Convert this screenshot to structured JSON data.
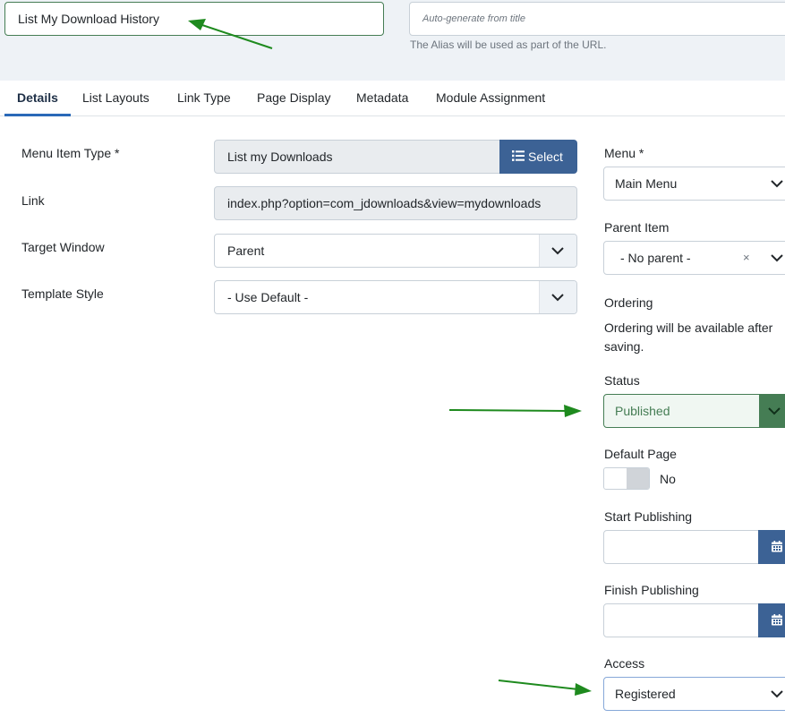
{
  "header": {
    "title_value": "List My Download History",
    "alias_placeholder": "Auto-generate from title",
    "alias_help": "The Alias will be used as part of the URL."
  },
  "tabs": [
    {
      "label": "Details",
      "active": true
    },
    {
      "label": "List Layouts"
    },
    {
      "label": "Link Type"
    },
    {
      "label": "Page Display"
    },
    {
      "label": "Metadata"
    },
    {
      "label": "Module Assignment"
    }
  ],
  "details": {
    "menu_item_type_label": "Menu Item Type *",
    "menu_item_type_value": "List my Downloads",
    "select_button_label": "Select",
    "link_label": "Link",
    "link_value": "index.php?option=com_jdownloads&view=mydownloads",
    "target_window_label": "Target Window",
    "target_window_value": "Parent",
    "template_style_label": "Template Style",
    "template_style_value": "- Use Default -"
  },
  "sidebar": {
    "menu_label": "Menu *",
    "menu_value": "Main Menu",
    "parent_item_label": "Parent Item",
    "parent_item_value": "- No parent -",
    "parent_clear": "×",
    "ordering_label": "Ordering",
    "ordering_help": "Ordering will be available after saving.",
    "status_label": "Status",
    "status_value": "Published",
    "default_page_label": "Default Page",
    "default_page_value": "No",
    "start_publishing_label": "Start Publishing",
    "finish_publishing_label": "Finish Publishing",
    "access_label": "Access",
    "access_value": "Registered"
  },
  "colors": {
    "accent_blue": "#3c6295",
    "success_green": "#457d54",
    "annotation_arrow": "#1e8a1e"
  }
}
